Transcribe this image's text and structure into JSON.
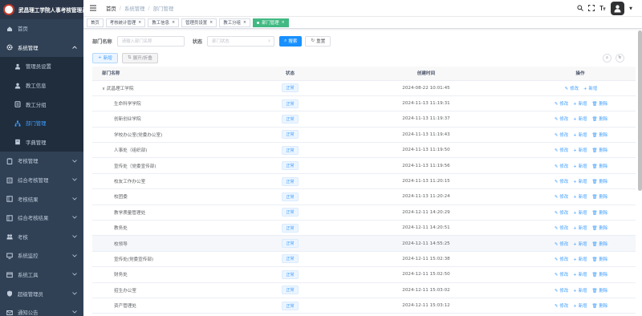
{
  "app": {
    "title": "武昌理工学院人事考核管理系统"
  },
  "sidebar": {
    "items": [
      {
        "label": "首页",
        "icon": "home-icon"
      },
      {
        "label": "系统管理",
        "icon": "gear-icon",
        "expanded": true
      },
      {
        "label": "管理员设置",
        "icon": "user-tie-icon",
        "sub": true
      },
      {
        "label": "教工信息",
        "icon": "person-icon",
        "sub": true
      },
      {
        "label": "教工分组",
        "icon": "group-icon",
        "sub": true
      },
      {
        "label": "部门管理",
        "icon": "tree-icon",
        "sub": true,
        "active": true
      },
      {
        "label": "字典管理",
        "icon": "dict-icon",
        "sub": true
      },
      {
        "label": "考核管理",
        "icon": "clipboard-icon"
      },
      {
        "label": "综合考核管理",
        "icon": "document-icon"
      },
      {
        "label": "考核结果",
        "icon": "chart-icon"
      },
      {
        "label": "综合考核结果",
        "icon": "chart-icon"
      },
      {
        "label": "考核",
        "icon": "people-icon"
      },
      {
        "label": "系统监控",
        "icon": "monitor-icon"
      },
      {
        "label": "系统工具",
        "icon": "tool-icon"
      },
      {
        "label": "超级管理员",
        "icon": "admin-icon"
      },
      {
        "label": "通知公告",
        "icon": "mail-icon"
      }
    ]
  },
  "navbar": {
    "breadcrumb": [
      "首页",
      "系统管理",
      "部门管理"
    ]
  },
  "tags": [
    {
      "label": "首页"
    },
    {
      "label": "考核统计管理"
    },
    {
      "label": "教工信息"
    },
    {
      "label": "管理员设置"
    },
    {
      "label": "教工分组"
    },
    {
      "label": "部门管理",
      "active": true
    }
  ],
  "filter": {
    "dept_label": "部门名称",
    "dept_placeholder": "请输入部门名称",
    "status_label": "状态",
    "status_placeholder": "部门状态",
    "search": "搜索",
    "reset": "重置"
  },
  "toolbar": {
    "add": "新增",
    "expand": "展开/折叠"
  },
  "table": {
    "headers": [
      "部门名称",
      "状态",
      "创建时间",
      "操作"
    ],
    "ops": {
      "edit": "修改",
      "add": "新增",
      "del": "删除"
    },
    "rows": [
      {
        "name": "武昌理工学院",
        "status": "正常",
        "time": "2024-08-22 10:01:45",
        "root": true
      },
      {
        "name": "生命科学学院",
        "status": "正常",
        "time": "2024-11-13 11:19:31"
      },
      {
        "name": "创新创业学院",
        "status": "正常",
        "time": "2024-11-13 11:19:37"
      },
      {
        "name": "学校办公室(党委办公室)",
        "status": "正常",
        "time": "2024-11-13 11:19:43"
      },
      {
        "name": "人事处（组织部)",
        "status": "正常",
        "time": "2024-11-13 11:19:50"
      },
      {
        "name": "宣传处（党委宣传部)",
        "status": "正常",
        "time": "2024-11-13 11:19:56"
      },
      {
        "name": "校友工作办公室",
        "status": "正常",
        "time": "2024-11-13 11:20:15"
      },
      {
        "name": "校团委",
        "status": "正常",
        "time": "2024-11-13 11:20:24"
      },
      {
        "name": "教学质量管理处",
        "status": "正常",
        "time": "2024-12-11 14:20:29"
      },
      {
        "name": "教务处",
        "status": "正常",
        "time": "2024-12-11 14:20:51"
      },
      {
        "name": "校领导",
        "status": "正常",
        "time": "2024-12-11 14:55:25",
        "hl": true
      },
      {
        "name": "宣传处(党委宣传部)",
        "status": "正常",
        "time": "2024-12-11 15:02:38"
      },
      {
        "name": "财务处",
        "status": "正常",
        "time": "2024-12-11 15:02:50"
      },
      {
        "name": "招生办公室",
        "status": "正常",
        "time": "2024-12-11 15:03:02"
      },
      {
        "name": "资产管理处",
        "status": "正常",
        "time": "2024-12-11 15:03:12"
      }
    ]
  }
}
